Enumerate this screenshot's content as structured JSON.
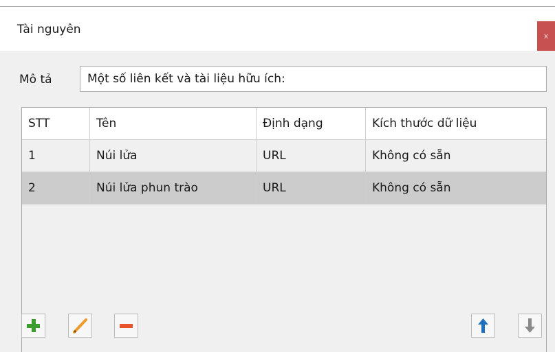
{
  "window": {
    "title": "Tài nguyên",
    "close_label": "x"
  },
  "description": {
    "label": "Mô tả",
    "value": "Một số liên kết và tài liệu hữu ích:"
  },
  "table": {
    "columns": [
      "STT",
      "Tên",
      "Định dạng",
      "Kích thước dữ liệu"
    ],
    "rows": [
      [
        "1",
        "Núi lửa",
        "URL",
        "Không có sẵn"
      ],
      [
        "2",
        "Núi lửa phun trào",
        "URL",
        "Không có sẵn"
      ]
    ],
    "selected_row": 2
  },
  "toolbar": {
    "buttons": [
      {
        "name": "add",
        "icon": "plus-icon",
        "color": "#3a9e2f"
      },
      {
        "name": "edit",
        "icon": "pencil-icon",
        "color": "#f09a2a"
      },
      {
        "name": "remove",
        "icon": "minus-icon",
        "color": "#e8532b"
      },
      {
        "name": "move-up",
        "icon": "arrow-up-icon",
        "color": "#1f6fc0"
      },
      {
        "name": "move-down",
        "icon": "arrow-down-icon",
        "color": "#8a8a8a"
      }
    ]
  },
  "colors": {
    "close_bg": "#c75050",
    "selected_row_bg": "#cccccc",
    "body_bg": "#f0f0f0"
  }
}
